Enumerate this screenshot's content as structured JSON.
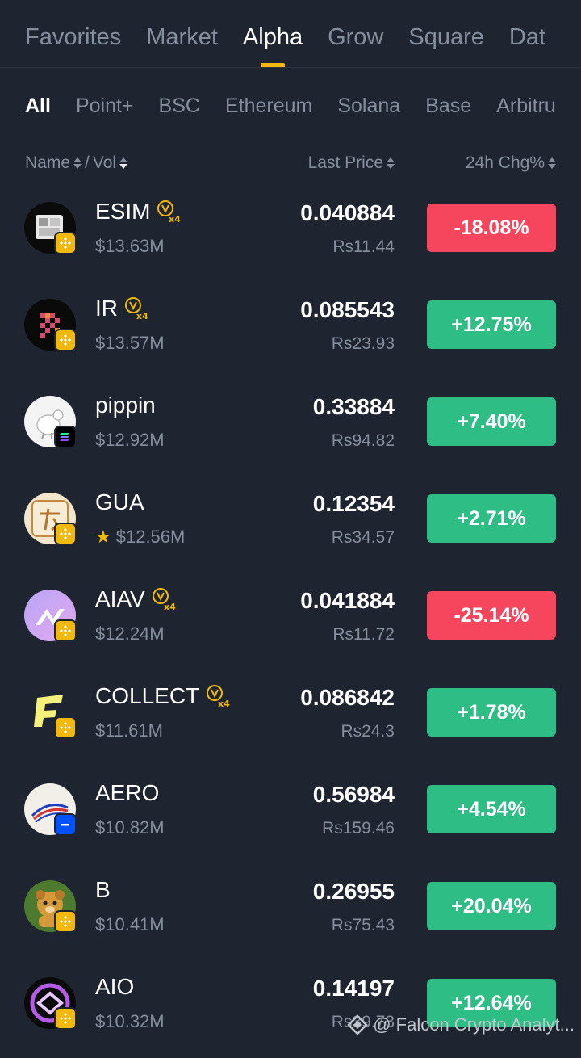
{
  "top_tabs": [
    {
      "label": "Favorites"
    },
    {
      "label": "Market"
    },
    {
      "label": "Alpha"
    },
    {
      "label": "Grow"
    },
    {
      "label": "Square"
    },
    {
      "label": "Dat"
    }
  ],
  "sub_tabs": [
    {
      "label": "All"
    },
    {
      "label": "Point+"
    },
    {
      "label": "BSC"
    },
    {
      "label": "Ethereum"
    },
    {
      "label": "Solana"
    },
    {
      "label": "Base"
    },
    {
      "label": "Arbitru"
    }
  ],
  "columns": {
    "name": "Name",
    "separator": "/",
    "vol": "Vol",
    "price": "Last Price",
    "change": "24h Chg%"
  },
  "rows": [
    {
      "symbol": "ESIM",
      "vol": "$13.63M",
      "price": "0.040884",
      "fiat": "Rs11.44",
      "change": "-18.08%",
      "direction": "down",
      "chain": "bsc",
      "badge": "x4"
    },
    {
      "symbol": "IR",
      "vol": "$13.57M",
      "price": "0.085543",
      "fiat": "Rs23.93",
      "change": "+12.75%",
      "direction": "up",
      "chain": "bsc",
      "badge": "x4"
    },
    {
      "symbol": "pippin",
      "vol": "$12.92M",
      "price": "0.33884",
      "fiat": "Rs94.82",
      "change": "+7.40%",
      "direction": "up",
      "chain": "solana",
      "badge": ""
    },
    {
      "symbol": "GUA",
      "vol": "$12.56M",
      "price": "0.12354",
      "fiat": "Rs34.57",
      "change": "+2.71%",
      "direction": "up",
      "chain": "bsc",
      "badge": "",
      "starred": true
    },
    {
      "symbol": "AIAV",
      "vol": "$12.24M",
      "price": "0.041884",
      "fiat": "Rs11.72",
      "change": "-25.14%",
      "direction": "down",
      "chain": "bsc",
      "badge": "x4"
    },
    {
      "symbol": "COLLECT",
      "vol": "$11.61M",
      "price": "0.086842",
      "fiat": "Rs24.3",
      "change": "+1.78%",
      "direction": "up",
      "chain": "bsc",
      "badge": "x4"
    },
    {
      "symbol": "AERO",
      "vol": "$10.82M",
      "price": "0.56984",
      "fiat": "Rs159.46",
      "change": "+4.54%",
      "direction": "up",
      "chain": "base",
      "badge": ""
    },
    {
      "symbol": "B",
      "vol": "$10.41M",
      "price": "0.26955",
      "fiat": "Rs75.43",
      "change": "+20.04%",
      "direction": "up",
      "chain": "bsc",
      "badge": ""
    },
    {
      "symbol": "AIO",
      "vol": "$10.32M",
      "price": "0.14197",
      "fiat": "Rs39.73",
      "change": "+12.64%",
      "direction": "up",
      "chain": "bsc",
      "badge": ""
    }
  ],
  "watermark": "@ Falcon Crypto Analyt...",
  "colors": {
    "up": "#2ebd85",
    "down": "#f6465d",
    "accent": "#f0b90b",
    "background": "#1f2530"
  }
}
